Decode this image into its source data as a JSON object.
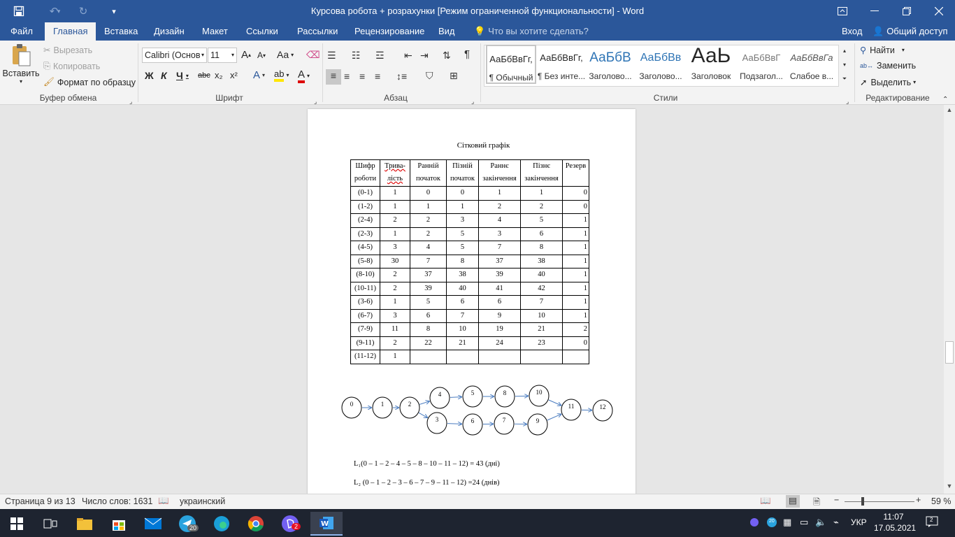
{
  "window": {
    "title": "Курсова робота  + розрахунки [Режим ограниченной функциональности] - Word",
    "qat_more": "▾"
  },
  "tabs": {
    "file": "Файл",
    "home": "Главная",
    "insert": "Вставка",
    "design": "Дизайн",
    "layout": "Макет",
    "references": "Ссылки",
    "mailings": "Рассылки",
    "review": "Рецензирование",
    "view": "Вид",
    "tell_me": "Что вы хотите сделать?",
    "signin": "Вход",
    "share": "Общий доступ"
  },
  "ribbon": {
    "clipboard": {
      "paste": "Вставить",
      "cut": "Вырезать",
      "copy": "Копировать",
      "format_painter": "Формат по образцу",
      "label": "Буфер обмена"
    },
    "font": {
      "name": "Calibri (Основ",
      "size": "11",
      "bold": "Ж",
      "italic": "К",
      "underline": "Ч",
      "strike": "abc",
      "sub": "x₂",
      "sup": "x²",
      "change_case": "Aa",
      "grow": "A",
      "shrink": "A",
      "label": "Шрифт"
    },
    "paragraph": {
      "label": "Абзац"
    },
    "styles": {
      "items": [
        {
          "sample": "АаБбВвГг,",
          "name": "¶ Обычный"
        },
        {
          "sample": "АаБбВвГг,",
          "name": "¶ Без инте..."
        },
        {
          "sample": "АаБбВ",
          "name": "Заголово..."
        },
        {
          "sample": "АаБбВв",
          "name": "Заголово..."
        },
        {
          "sample": "АаЬ",
          "name": "Заголовок"
        },
        {
          "sample": "АаБбВвГ",
          "name": "Подзагол..."
        },
        {
          "sample": "АаБбВвГа",
          "name": "Слабое в..."
        }
      ],
      "label": "Стили"
    },
    "editing": {
      "find": "Найти",
      "replace": "Заменить",
      "select": "Выделить",
      "label": "Редактирование"
    }
  },
  "document": {
    "heading": "Сітковий графік",
    "table": {
      "headers": [
        "Шифр роботи",
        "Трива-лість",
        "Ранній початок",
        "Пізній початок",
        "Раннє закінчення",
        "Пізнє закінчення",
        "Резерв"
      ],
      "rows": [
        [
          "(0-1)",
          "1",
          "0",
          "0",
          "1",
          "1",
          "0"
        ],
        [
          "(1-2)",
          "1",
          "1",
          "1",
          "2",
          "2",
          "0"
        ],
        [
          "(2-4)",
          "2",
          "2",
          "3",
          "4",
          "5",
          "1"
        ],
        [
          "(2-3)",
          "1",
          "2",
          "5",
          "3",
          "6",
          "1"
        ],
        [
          "(4-5)",
          "3",
          "4",
          "5",
          "7",
          "8",
          "1"
        ],
        [
          "(5-8)",
          "30",
          "7",
          "8",
          "37",
          "38",
          "1"
        ],
        [
          "(8-10)",
          "2",
          "37",
          "38",
          "39",
          "40",
          "1"
        ],
        [
          "(10-11)",
          "2",
          "39",
          "40",
          "41",
          "42",
          "1"
        ],
        [
          "(3-6)",
          "1",
          "5",
          "6",
          "6",
          "7",
          "1"
        ],
        [
          "(6-7)",
          "3",
          "6",
          "7",
          "9",
          "10",
          "1"
        ],
        [
          "(7-9)",
          "11",
          "8",
          "10",
          "19",
          "21",
          "2"
        ],
        [
          "(9-11)",
          "2",
          "22",
          "21",
          "24",
          "23",
          "0"
        ],
        [
          "(11-12)",
          "1",
          "",
          "",
          "",
          "",
          ""
        ]
      ]
    },
    "diagram_nodes": [
      "0",
      "1",
      "2",
      "4",
      "5",
      "8",
      "10",
      "3",
      "6",
      "7",
      "9",
      "11",
      "12"
    ],
    "line1": "L₁(0 – 1 – 2 – 4  – 5 – 8 – 10  – 11  – 12) = 43 (дні)",
    "line2": "L₂ (0 – 1 – 2 – 3 – 6 – 7 – 9 – 11 – 12) =24 (днів)"
  },
  "status": {
    "page": "Страница 9 из 13",
    "words": "Число слов: 1631",
    "language": "украинский",
    "zoom": "59 %"
  },
  "taskbar": {
    "telegram_badge": "20",
    "viber_badge": "2",
    "tray_badge": "20",
    "lang": "УКР",
    "time": "11:07",
    "date": "17.05.2021",
    "notif_count": "2"
  }
}
